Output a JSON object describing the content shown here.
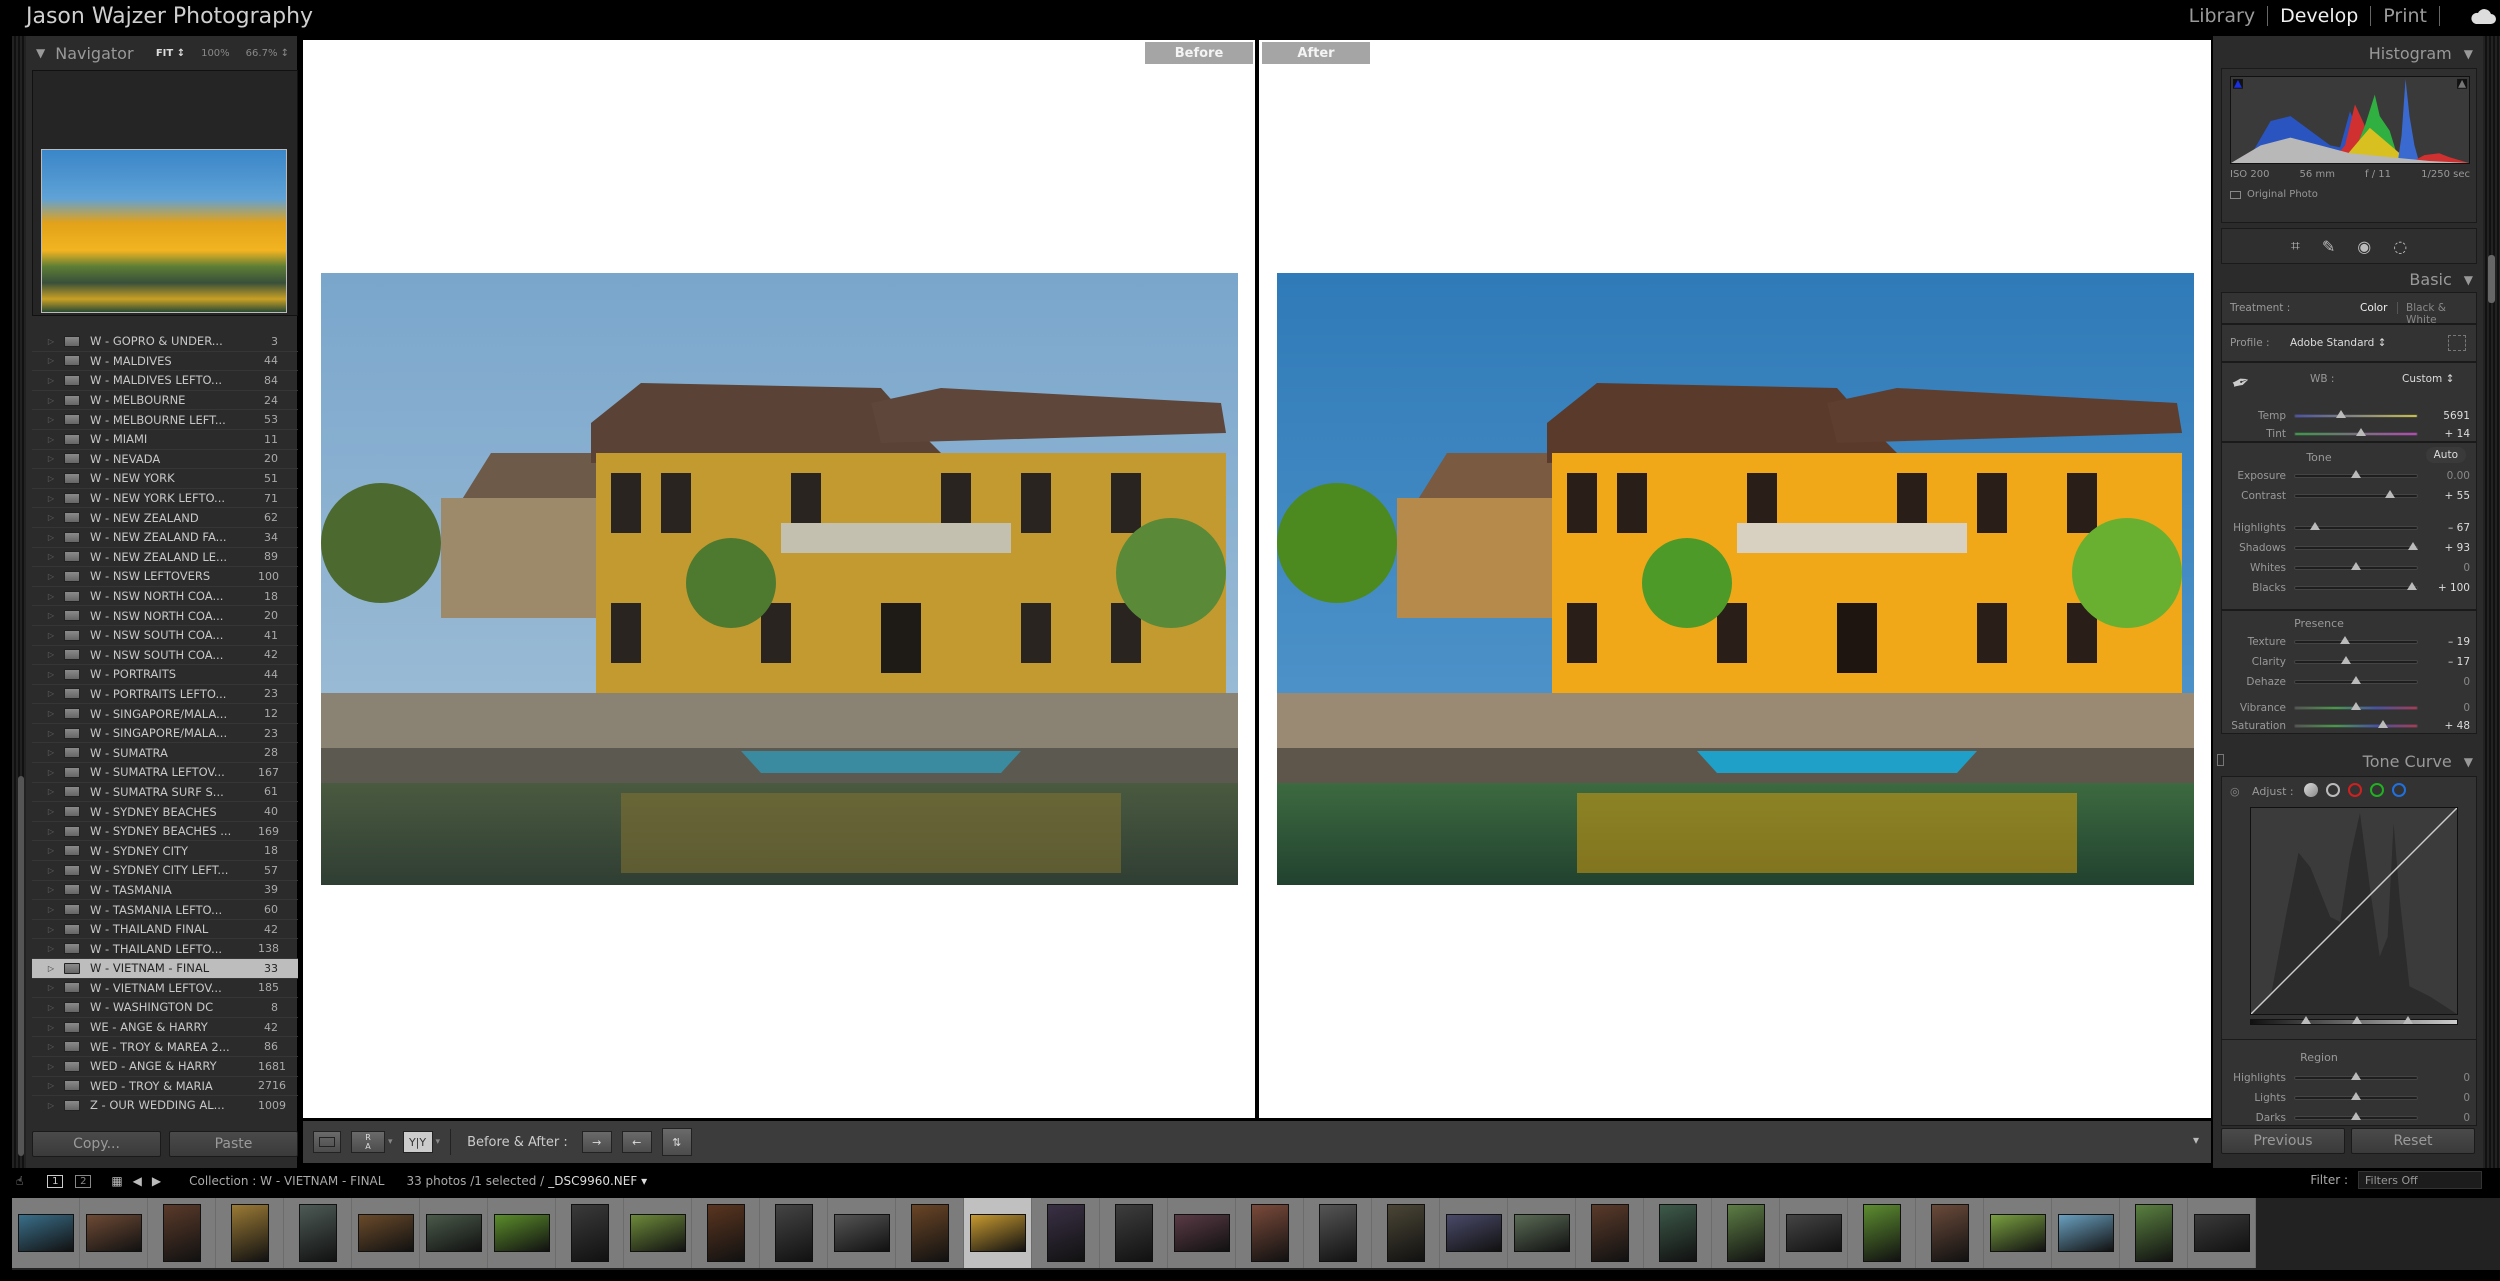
{
  "topbar": {
    "identity_plate": "Jason Wajzer Photography",
    "modules": [
      {
        "label": "Library",
        "active": false
      },
      {
        "label": "Develop",
        "active": true
      },
      {
        "label": "Print",
        "active": false
      }
    ],
    "cloud_icon": "cloud-icon"
  },
  "navigator": {
    "title": "Navigator",
    "zoom_options": [
      "FIT ↕",
      "100%",
      "66.7% ↕"
    ],
    "selected_zoom": "FIT"
  },
  "collections": [
    {
      "name": "W - GOPRO & UNDER...",
      "count": "3"
    },
    {
      "name": "W - MALDIVES",
      "count": "44"
    },
    {
      "name": "W - MALDIVES LEFTO...",
      "count": "84"
    },
    {
      "name": "W - MELBOURNE",
      "count": "24"
    },
    {
      "name": "W - MELBOURNE LEFT...",
      "count": "53"
    },
    {
      "name": "W - MIAMI",
      "count": "11"
    },
    {
      "name": "W - NEVADA",
      "count": "20"
    },
    {
      "name": "W - NEW YORK",
      "count": "51"
    },
    {
      "name": "W - NEW YORK LEFTO...",
      "count": "71"
    },
    {
      "name": "W - NEW ZEALAND",
      "count": "62"
    },
    {
      "name": "W - NEW ZEALAND FA...",
      "count": "34"
    },
    {
      "name": "W - NEW ZEALAND LE...",
      "count": "89"
    },
    {
      "name": "W - NSW LEFTOVERS",
      "count": "100"
    },
    {
      "name": "W - NSW NORTH COA...",
      "count": "18"
    },
    {
      "name": "W - NSW NORTH COA...",
      "count": "20"
    },
    {
      "name": "W - NSW SOUTH COA...",
      "count": "41"
    },
    {
      "name": "W - NSW SOUTH COA...",
      "count": "42"
    },
    {
      "name": "W - PORTRAITS",
      "count": "44"
    },
    {
      "name": "W - PORTRAITS LEFTO...",
      "count": "23"
    },
    {
      "name": "W - SINGAPORE/MALA...",
      "count": "12"
    },
    {
      "name": "W - SINGAPORE/MALA...",
      "count": "23"
    },
    {
      "name": "W - SUMATRA",
      "count": "28"
    },
    {
      "name": "W - SUMATRA LEFTOV...",
      "count": "167"
    },
    {
      "name": "W - SUMATRA SURF S...",
      "count": "61"
    },
    {
      "name": "W - SYDNEY BEACHES",
      "count": "40"
    },
    {
      "name": "W - SYDNEY BEACHES ...",
      "count": "169"
    },
    {
      "name": "W - SYDNEY CITY",
      "count": "18"
    },
    {
      "name": "W - SYDNEY CITY LEFT...",
      "count": "57"
    },
    {
      "name": "W - TASMANIA",
      "count": "39"
    },
    {
      "name": "W - TASMANIA LEFTO...",
      "count": "60"
    },
    {
      "name": "W - THAILAND FINAL",
      "count": "42"
    },
    {
      "name": "W - THAILAND LEFTO...",
      "count": "138"
    },
    {
      "name": "W - VIETNAM - FINAL",
      "count": "33",
      "selected": true
    },
    {
      "name": "W - VIETNAM LEFTOV...",
      "count": "185"
    },
    {
      "name": "W - WASHINGTON DC",
      "count": "8"
    },
    {
      "name": "WE - ANGE & HARRY",
      "count": "42"
    },
    {
      "name": "WE - TROY & MAREA 2...",
      "count": "86"
    },
    {
      "name": "WED - ANGE & HARRY",
      "count": "1681"
    },
    {
      "name": "WED - TROY & MARIA",
      "count": "2716"
    },
    {
      "name": "Z - OUR WEDDING AL...",
      "count": "1009"
    }
  ],
  "left_buttons": {
    "copy": "Copy...",
    "paste": "Paste"
  },
  "view": {
    "before_label": "Before",
    "after_label": "After"
  },
  "toolbar": {
    "ba_label": "Before & After :",
    "ra_top": "R",
    "ra_bottom": "A",
    "yy": "Y|Y",
    "copy_after_to_before": "→",
    "copy_before_to_after": "←",
    "swap": "⇅",
    "dropdown": "▾"
  },
  "histogram": {
    "title": "Histogram",
    "iso": "ISO 200",
    "focal": "56 mm",
    "aperture": "f / 11",
    "shutter": "1/250 sec",
    "original_photo": "Original Photo"
  },
  "basic": {
    "title": "Basic",
    "treatment_label": "Treatment :",
    "treatment_color": "Color",
    "treatment_bw": "Black & White",
    "profile_label": "Profile :",
    "profile_value": "Adobe Standard ↕",
    "wb_label": "WB :",
    "wb_value": "Custom ↕",
    "tone_label": "Tone",
    "auto_label": "Auto",
    "presence_label": "Presence",
    "sliders": {
      "temp": {
        "label": "Temp",
        "value": "5691",
        "pos": 0.38
      },
      "tint": {
        "label": "Tint",
        "value": "+ 14",
        "pos": 0.54
      },
      "exposure": {
        "label": "Exposure",
        "value": "0.00",
        "pos": 0.5
      },
      "contrast": {
        "label": "Contrast",
        "value": "+ 55",
        "pos": 0.775
      },
      "highlights": {
        "label": "Highlights",
        "value": "– 67",
        "pos": 0.165
      },
      "shadows": {
        "label": "Shadows",
        "value": "+ 93",
        "pos": 0.965
      },
      "whites": {
        "label": "Whites",
        "value": "0",
        "pos": 0.5
      },
      "blacks": {
        "label": "Blacks",
        "value": "+ 100",
        "pos": 0.96
      },
      "texture": {
        "label": "Texture",
        "value": "– 19",
        "pos": 0.41
      },
      "clarity": {
        "label": "Clarity",
        "value": "– 17",
        "pos": 0.42
      },
      "dehaze": {
        "label": "Dehaze",
        "value": "0",
        "pos": 0.5
      },
      "vibrance": {
        "label": "Vibrance",
        "value": "0",
        "pos": 0.5
      },
      "saturation": {
        "label": "Saturation",
        "value": "+ 48",
        "pos": 0.72
      }
    }
  },
  "tone_curve": {
    "title": "Tone Curve",
    "adjust_label": "Adjust :",
    "region_label": "Region",
    "sliders": {
      "highlights": {
        "label": "Highlights",
        "value": "0",
        "pos": 0.5
      },
      "lights": {
        "label": "Lights",
        "value": "0",
        "pos": 0.5
      },
      "darks": {
        "label": "Darks",
        "value": "0",
        "pos": 0.5
      }
    }
  },
  "right_buttons": {
    "previous": "Previous",
    "reset": "Reset"
  },
  "filmbar": {
    "screen1": "1",
    "screen2": "2",
    "source": "Collection : W - VIETNAM - FINAL",
    "count": "33 photos /1 selected /",
    "filename": "_DSC9960.NEF ▾",
    "filter_label": "Filter :",
    "filter_value": "Filters Off"
  },
  "filmstrip": {
    "selected_index": 14,
    "thumbs": [
      {
        "orient": "land",
        "color": "#3a6f8a"
      },
      {
        "orient": "land",
        "color": "#6e4a35"
      },
      {
        "orient": "port",
        "color": "#5a3a2a"
      },
      {
        "orient": "port",
        "color": "#9b7a35"
      },
      {
        "orient": "port",
        "color": "#4d5a55"
      },
      {
        "orient": "land",
        "color": "#6a4a2a"
      },
      {
        "orient": "land",
        "color": "#4a5a4a"
      },
      {
        "orient": "land",
        "color": "#5b8d2a"
      },
      {
        "orient": "port",
        "color": "#3a3a3a"
      },
      {
        "orient": "land",
        "color": "#6d8a3a"
      },
      {
        "orient": "port",
        "color": "#5a3520"
      },
      {
        "orient": "port",
        "color": "#444444"
      },
      {
        "orient": "land",
        "color": "#555555"
      },
      {
        "orient": "port",
        "color": "#6a4526"
      },
      {
        "orient": "land",
        "color": "#c89a30"
      },
      {
        "orient": "port",
        "color": "#3a3045"
      },
      {
        "orient": "port",
        "color": "#3d3d3d"
      },
      {
        "orient": "land",
        "color": "#5a3a45"
      },
      {
        "orient": "port",
        "color": "#7a4a3a"
      },
      {
        "orient": "port",
        "color": "#555555"
      },
      {
        "orient": "port",
        "color": "#4a4535"
      },
      {
        "orient": "land",
        "color": "#4a4a6a"
      },
      {
        "orient": "land",
        "color": "#5a6a55"
      },
      {
        "orient": "port",
        "color": "#5a3a2a"
      },
      {
        "orient": "port",
        "color": "#3d5a4a"
      },
      {
        "orient": "port",
        "color": "#5d7d45"
      },
      {
        "orient": "land",
        "color": "#444444"
      },
      {
        "orient": "port",
        "color": "#5d8d30"
      },
      {
        "orient": "port",
        "color": "#6a4a3a"
      },
      {
        "orient": "land",
        "color": "#7aa040"
      },
      {
        "orient": "land",
        "color": "#6aa0c0"
      },
      {
        "orient": "port",
        "color": "#5a8040"
      },
      {
        "orient": "land",
        "color": "#3a3a3a"
      }
    ]
  }
}
